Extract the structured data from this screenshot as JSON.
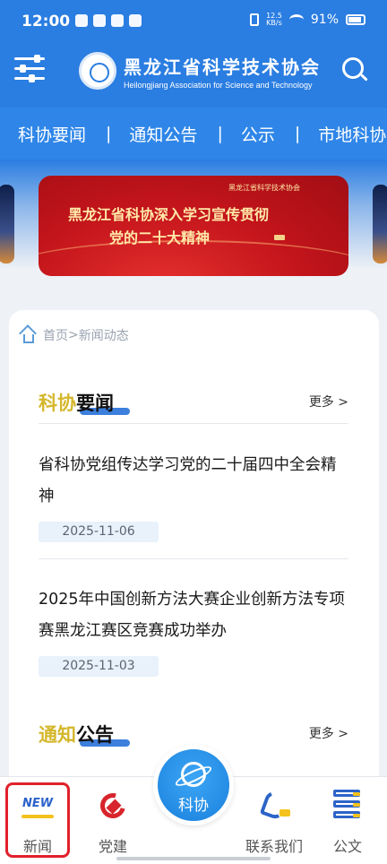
{
  "status_bar": {
    "time": "12:00",
    "net_speed_value": "12.5",
    "net_speed_unit": "KB/s",
    "battery": "91%"
  },
  "header": {
    "org_name_cn": "黑龙江省科学技术协会",
    "org_name_en": "Heilongjiang Association for Science and Technology"
  },
  "nav": {
    "items": [
      "科协要闻",
      "通知公告",
      "公示",
      "市地科协"
    ],
    "separator": "|"
  },
  "banner": {
    "line1": "黑龙江省科协深入学习宣传贯彻",
    "line2": "党的二十大精神",
    "sub": "黑龙江省科学技术协会"
  },
  "breadcrumb": {
    "home": "首页",
    "sep": ">",
    "current": "新闻动态"
  },
  "sections": [
    {
      "title_highlight": "科协",
      "title_rest": "要闻",
      "more": "更多 >",
      "items": [
        {
          "title": "省科协党组传达学习党的二十届四中全会精神",
          "date": "2025-11-06"
        },
        {
          "title": "2025年中国创新方法大赛企业创新方法专项赛黑龙江赛区竞赛成功举办",
          "date": "2025-11-03"
        }
      ]
    },
    {
      "title_highlight": "通知",
      "title_rest": "公告",
      "more": "更多 >"
    }
  ],
  "tabbar": {
    "news": "新闻",
    "news_badge": "NEW",
    "party": "党建",
    "center": "科协",
    "contact": "联系我们",
    "docs": "公文"
  },
  "colors": {
    "primary_blue": "#2a7de1",
    "nav_blue": "#2f86e8",
    "highlight_gold": "#d4b72b",
    "selected_frame_red": "#e0212b"
  }
}
